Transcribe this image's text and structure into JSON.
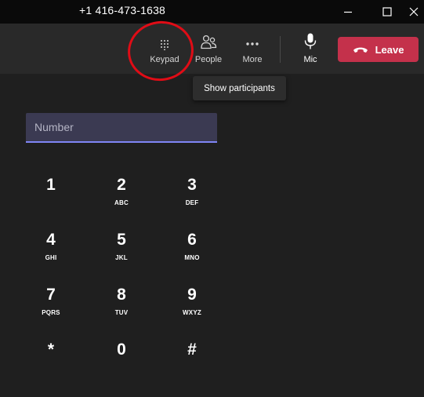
{
  "window": {
    "title": "+1 416-473-1638",
    "controls": [
      "minimize",
      "maximize",
      "close"
    ]
  },
  "toolbar": {
    "keypad_label": "Keypad",
    "people_label": "People",
    "more_label": "More",
    "mic_label": "Mic",
    "leave_label": "Leave",
    "tooltip": "Show participants"
  },
  "dialpad": {
    "number_placeholder": "Number",
    "keys": [
      {
        "digit": "1",
        "letters": ""
      },
      {
        "digit": "2",
        "letters": "ABC"
      },
      {
        "digit": "3",
        "letters": "DEF"
      },
      {
        "digit": "4",
        "letters": "GHI"
      },
      {
        "digit": "5",
        "letters": "JKL"
      },
      {
        "digit": "6",
        "letters": "MNO"
      },
      {
        "digit": "7",
        "letters": "PQRS"
      },
      {
        "digit": "8",
        "letters": "TUV"
      },
      {
        "digit": "9",
        "letters": "WXYZ"
      },
      {
        "digit": "*",
        "letters": ""
      },
      {
        "digit": "0",
        "letters": ""
      },
      {
        "digit": "#",
        "letters": ""
      }
    ]
  },
  "colors": {
    "background": "#1f1f1f",
    "toolbar": "#292929",
    "leave_button": "#c4314b",
    "input_underline": "#7f85f5",
    "annotation": "#e00c16"
  }
}
